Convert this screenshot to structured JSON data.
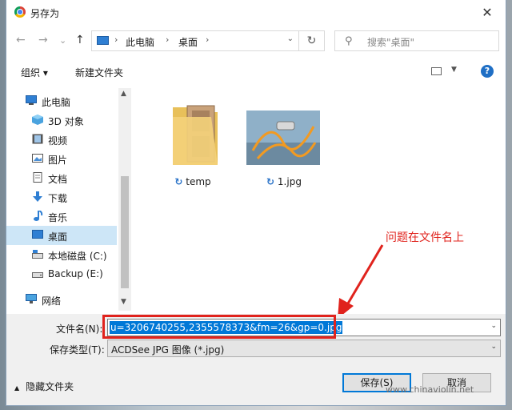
{
  "window": {
    "title": "另存为",
    "close": "✕"
  },
  "nav": {
    "back": "←",
    "forward": "→",
    "recent": "⌄",
    "up": "↑"
  },
  "address": {
    "crumbs": [
      "此电脑",
      "桌面"
    ],
    "sep": "›",
    "dropdown": "⌄",
    "refresh": "↻"
  },
  "search": {
    "icon": "⚲",
    "placeholder": "搜索\"桌面\""
  },
  "toolbar": {
    "organize": "组织 ▾",
    "new_folder": "新建文件夹",
    "view_dd": "▼",
    "help": "?"
  },
  "sidebar": {
    "items": [
      {
        "label": "此电脑",
        "icon": "pc-icon"
      },
      {
        "label": "3D 对象",
        "icon": "cube-icon"
      },
      {
        "label": "视频",
        "icon": "video-icon"
      },
      {
        "label": "图片",
        "icon": "picture-icon"
      },
      {
        "label": "文档",
        "icon": "document-icon"
      },
      {
        "label": "下载",
        "icon": "download-icon"
      },
      {
        "label": "音乐",
        "icon": "music-icon"
      },
      {
        "label": "桌面",
        "icon": "desktop-icon",
        "selected": true
      },
      {
        "label": "本地磁盘 (C:)",
        "icon": "drive-c-icon"
      },
      {
        "label": "Backup (E:)",
        "icon": "drive-e-icon"
      },
      {
        "label": "网络",
        "icon": "network-icon"
      }
    ],
    "scroll_up": "▲",
    "scroll_down": "▼"
  },
  "files": [
    {
      "name": "temp",
      "type": "folder"
    },
    {
      "name": "1.jpg",
      "type": "image"
    }
  ],
  "sync_glyph": "↻",
  "annotation": "问题在文件名上",
  "form": {
    "filename_label": "文件名(N):",
    "filename_value": "u=3206740255,2355578373&fm=26&gp=0.jpg",
    "filetype_label": "保存类型(T):",
    "filetype_value": "ACDSee JPG 图像 (*.jpg)",
    "dropdown": "⌄"
  },
  "footer": {
    "hide_folders": "隐藏文件夹",
    "save": "保存(S)",
    "cancel": "取消"
  },
  "watermark": "www.chinaviolin.net",
  "colors": {
    "accent": "#0078d7",
    "annotation": "#e0231d",
    "selection": "#cde6f7"
  }
}
